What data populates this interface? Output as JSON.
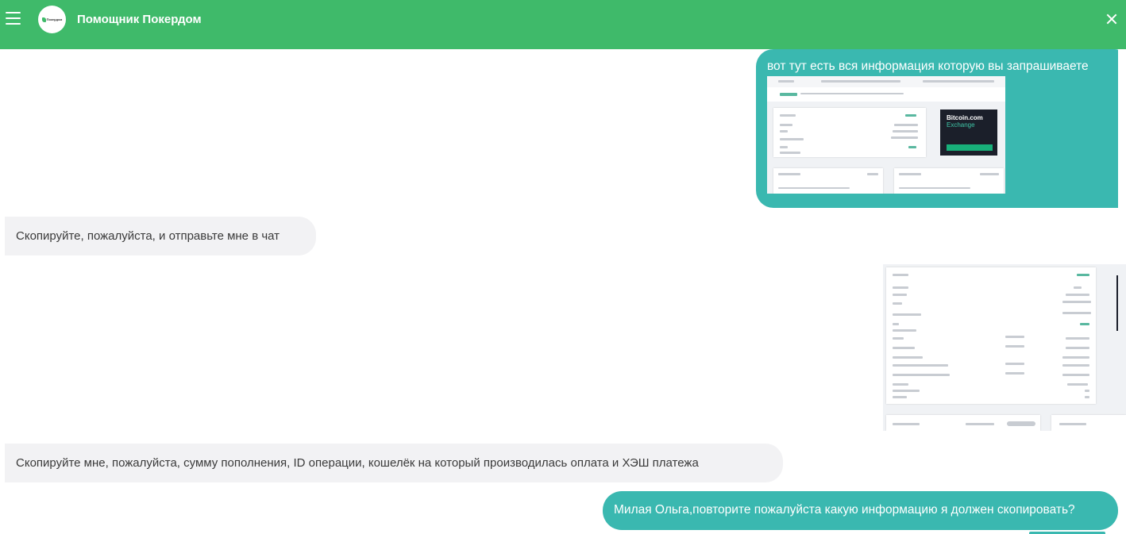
{
  "header": {
    "title": "Помощник Покердом",
    "logo_text": "Покердом",
    "bg_color": "#3fba6a"
  },
  "icons": {
    "menu": "hamburger-icon",
    "close": "close-icon"
  },
  "messages": [
    {
      "from": "user",
      "text": "вот тут есть вся информация которую вы запрашиваете",
      "attachment": "screenshot"
    },
    {
      "from": "operator",
      "text": "Скопируйте, пожалуйста, и отправьте мне в чат"
    },
    {
      "from": "user",
      "attachment": "screenshot"
    },
    {
      "from": "operator",
      "text": "Скопируйте мне, пожалуйста, сумму пополнения, ID операции, кошелёк на который производилась оплата и ХЭШ платежа"
    },
    {
      "from": "user",
      "text": "Милая Ольга,повторите пожалуйста какую информацию я должен скопировать?"
    }
  ],
  "attachment1": {
    "ad_title": "Bitcoin.com",
    "ad_subtitle": "Exchange"
  },
  "colors": {
    "user_bubble": "#3ab8b0",
    "operator_bubble": "#f2f2f4"
  }
}
